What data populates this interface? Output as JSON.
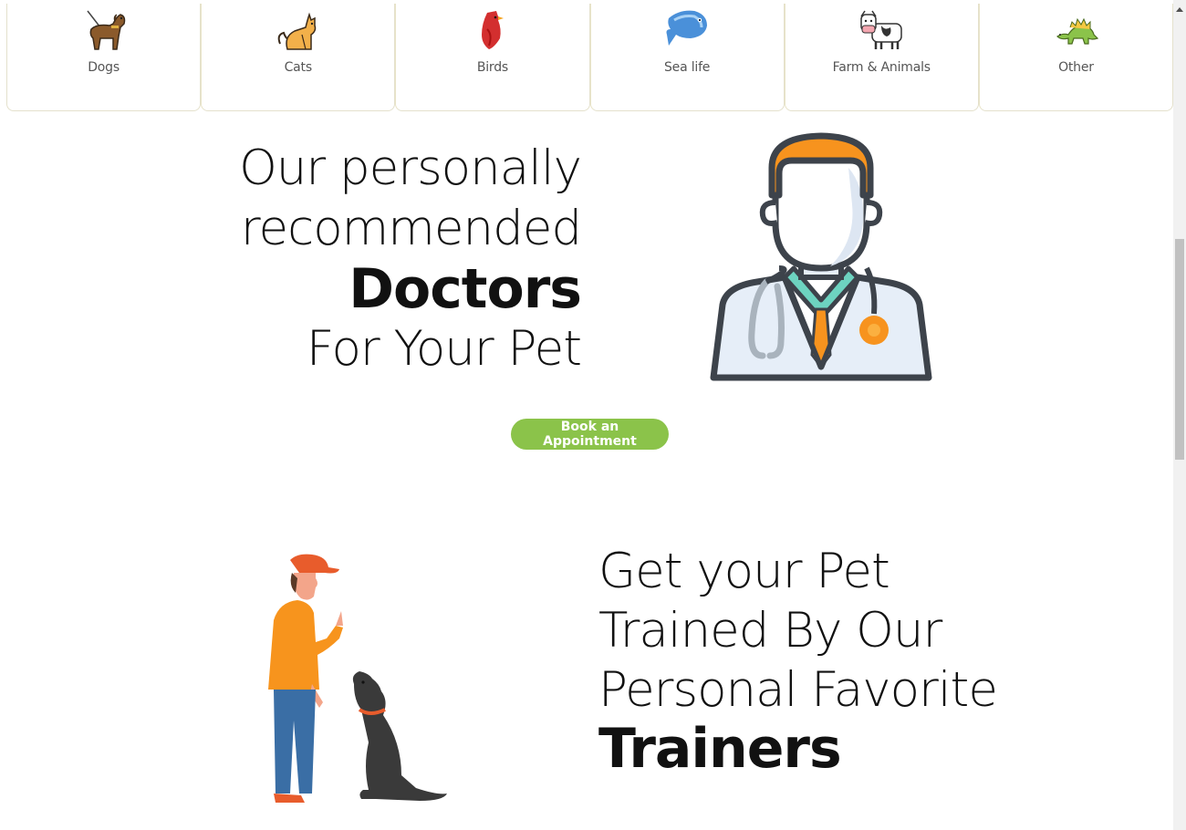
{
  "categories": [
    {
      "label": "Dogs",
      "icon": "dog-icon"
    },
    {
      "label": "Cats",
      "icon": "cat-icon"
    },
    {
      "label": "Birds",
      "icon": "bird-icon"
    },
    {
      "label": "Sea life",
      "icon": "fish-icon"
    },
    {
      "label": "Farm & Animals",
      "icon": "cow-icon"
    },
    {
      "label": "Other",
      "icon": "dinosaur-icon"
    }
  ],
  "doctors": {
    "line1": "Our personally",
    "line2": "recommended",
    "line3": "Doctors",
    "line4": "For Your Pet",
    "button": "Book an Appointment"
  },
  "trainers": {
    "line1": "Get your Pet",
    "line2": "Trained By Our",
    "line3": "Personal Favorite",
    "line4": "Trainers"
  },
  "colors": {
    "accent_green": "#8bc34a",
    "doctor_hair": "#f7931e",
    "trainer_shirt": "#f7941d",
    "outline": "#3d434b"
  }
}
